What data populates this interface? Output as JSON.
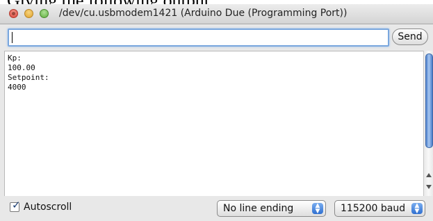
{
  "background_text": "Giving the following output:",
  "window": {
    "title": "/dev/cu.usbmodem1421 (Arduino Due (Programming Port))"
  },
  "send_bar": {
    "input_value": "",
    "send_label": "Send"
  },
  "output": {
    "lines": [
      "Kp:",
      "100.00",
      "Setpoint:",
      "4000"
    ]
  },
  "bottom": {
    "autoscroll_label": "Autoscroll",
    "autoscroll_checked": true,
    "line_ending_value": "No line ending",
    "baud_value": "115200 baud"
  },
  "colors": {
    "accent": "#2f6fd0",
    "focus_ring": "#7aa7de"
  }
}
